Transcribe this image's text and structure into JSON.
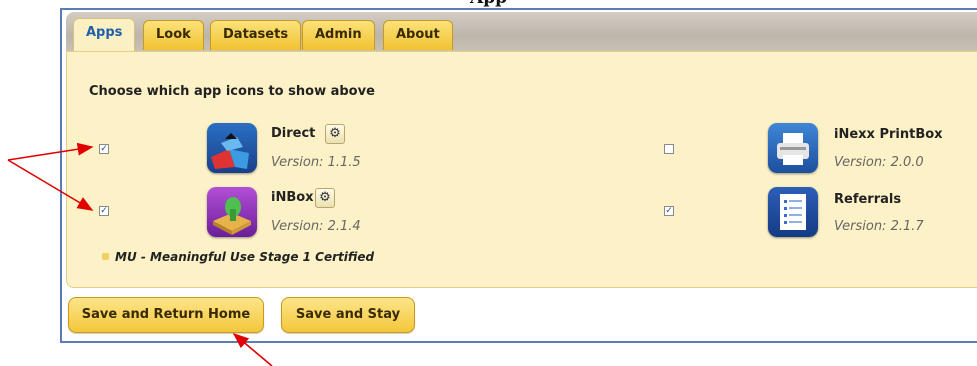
{
  "page_title": "App",
  "tabs": [
    {
      "label": "Apps",
      "active": true
    },
    {
      "label": "Look",
      "active": false
    },
    {
      "label": "Datasets",
      "active": false
    },
    {
      "label": "Admin",
      "active": false
    },
    {
      "label": "About",
      "active": false
    }
  ],
  "section_heading": "Choose which app icons to show above",
  "apps": [
    {
      "name": "Direct",
      "version": "Version: 1.1.5",
      "checked": true,
      "has_settings": true,
      "icon": "direct-app-icon"
    },
    {
      "name": "iNexx PrintBox",
      "version": "Version: 2.0.0",
      "checked": false,
      "has_settings": false,
      "icon": "printer-app-icon"
    },
    {
      "name": "iNBox",
      "version": "Version: 2.1.4",
      "checked": true,
      "has_settings": true,
      "icon": "inbox-app-icon"
    },
    {
      "name": "Referrals",
      "version": "Version: 2.1.7",
      "checked": true,
      "has_settings": false,
      "icon": "referrals-app-icon"
    }
  ],
  "certification_note": "MU - Meaningful Use Stage 1 Certified",
  "buttons": {
    "save_return": "Save and Return Home",
    "save_stay": "Save and Stay"
  },
  "colors": {
    "tab_gold": "#f1c232",
    "panel_bg": "#fcf1c7",
    "active_tab_text": "#1f5fa8",
    "annotation_arrow": "#e00000",
    "frame_border": "#5b7bb5"
  }
}
